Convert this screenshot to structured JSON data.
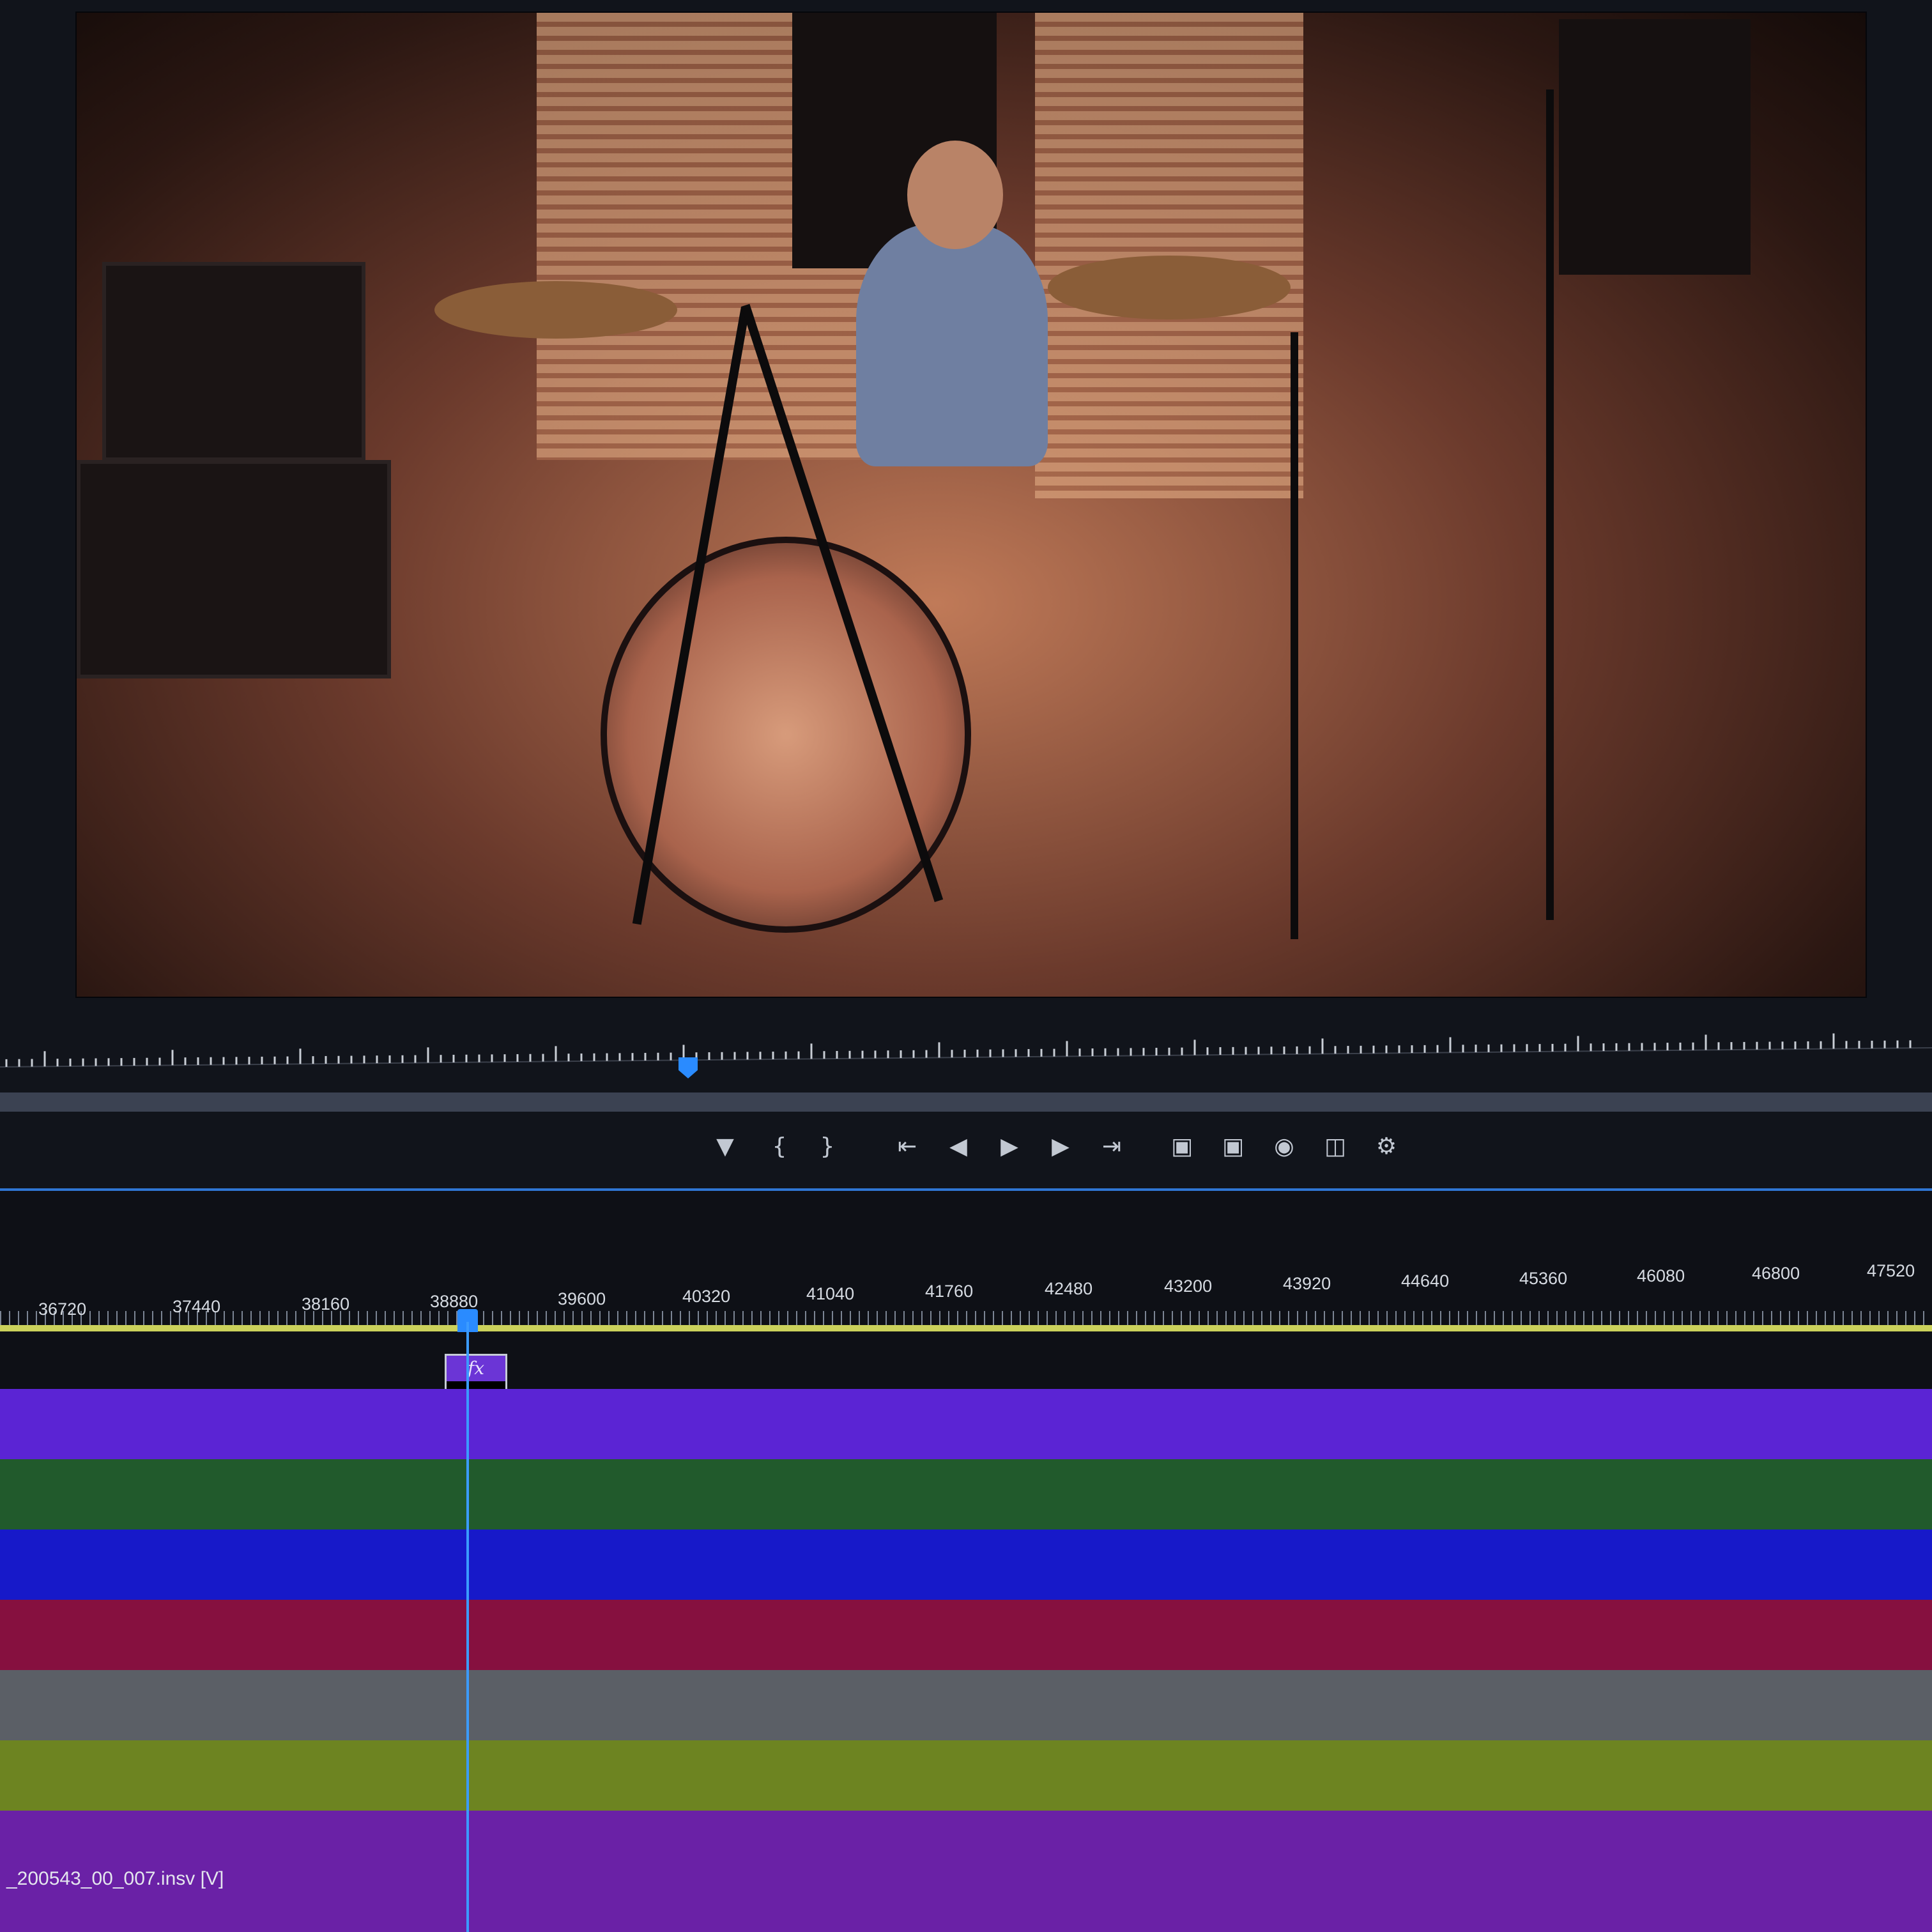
{
  "ruler": {
    "ticks": [
      "36720",
      "37440",
      "38160",
      "38880",
      "39600",
      "40320",
      "41040",
      "41760",
      "42480",
      "43200",
      "43920",
      "44640",
      "45360",
      "46080",
      "46800",
      "47520"
    ]
  },
  "fx_clip": {
    "label": "fx"
  },
  "clip": {
    "name": "_200543_00_007.insv [V]"
  },
  "transport_icons": [
    "marker-icon",
    "mark-in-icon",
    "mark-out-icon",
    "go-to-in-icon",
    "step-back-icon",
    "play-icon",
    "step-forward-icon",
    "go-to-out-icon",
    "insert-icon",
    "overwrite-icon",
    "export-frame-icon",
    "comparison-view-icon",
    "settings-icon"
  ],
  "colors": {
    "track_purple": "#5b24d4",
    "track_green": "#215a2c",
    "track_blue": "#1719c9",
    "track_red": "#86103f",
    "track_gray": "#5b5f66",
    "track_olive": "#6d8421",
    "track_violet": "#6a21a6",
    "playhead": "#3b9bff",
    "work_area": "#cbd15b"
  }
}
